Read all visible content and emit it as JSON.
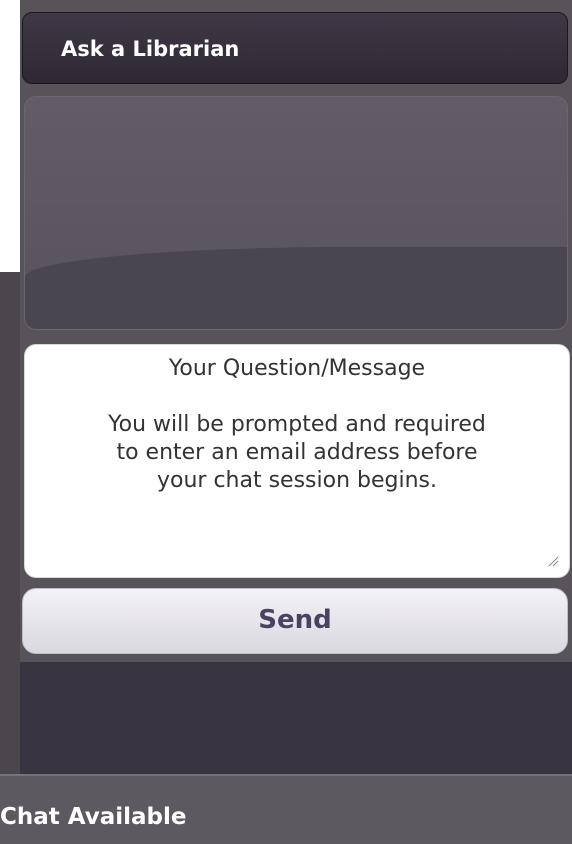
{
  "header": {
    "title": "Ask a Librarian"
  },
  "message_box": {
    "heading": "Your Question/Message",
    "notice_lines": [
      "You will be prompted and required",
      "to enter an email address before",
      "your chat session begins."
    ]
  },
  "send_button": {
    "label": "Send"
  },
  "footer": {
    "status": "Chat Available"
  },
  "colors": {
    "header_bg": "#2e2834",
    "panel_bg": "#575358",
    "button_text": "#4b4160",
    "dark_area": "#393441"
  },
  "icons": {
    "resize": "resize-grip-icon"
  }
}
